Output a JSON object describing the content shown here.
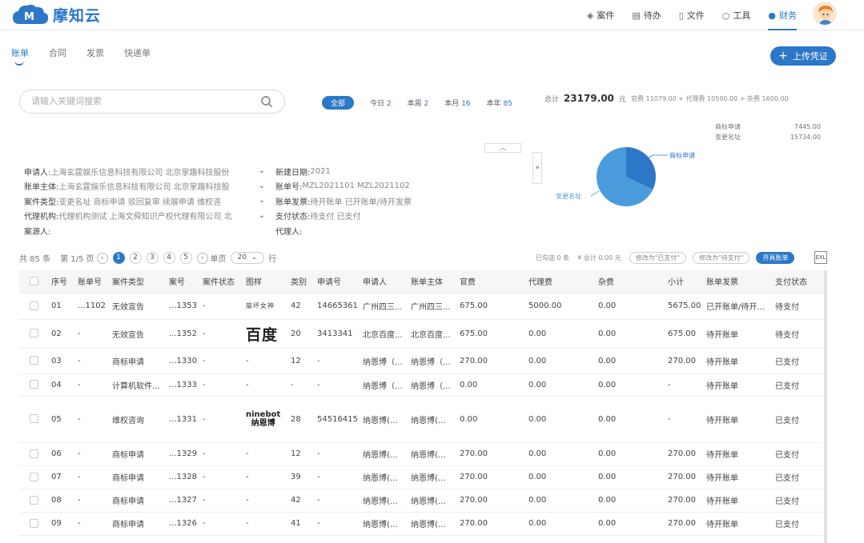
{
  "app": {
    "logo_text": "摩知云",
    "logo_mark": "M"
  },
  "topnav": [
    {
      "label": "案件",
      "icon": "layers-icon",
      "active": false
    },
    {
      "label": "待办",
      "icon": "calendar-icon",
      "active": false
    },
    {
      "label": "文件",
      "icon": "file-icon",
      "active": false
    },
    {
      "label": "工具",
      "icon": "search-tool-icon",
      "active": false
    },
    {
      "label": "财务",
      "icon": "money-bag-icon",
      "active": true
    }
  ],
  "subtabs": [
    {
      "label": "账单",
      "active": true
    },
    {
      "label": "合同",
      "active": false
    },
    {
      "label": "发票",
      "active": false
    },
    {
      "label": "快递单",
      "active": false
    }
  ],
  "upload_button": "上传凭证",
  "search": {
    "placeholder": "请输入关键词搜索"
  },
  "periods": [
    {
      "label": "全部",
      "count": "",
      "active": true
    },
    {
      "label": "今日",
      "count": "2",
      "active": false
    },
    {
      "label": "本周",
      "count": "2",
      "active": false
    },
    {
      "label": "本月",
      "count": "16",
      "active": false
    },
    {
      "label": "本年",
      "count": "85",
      "active": false
    }
  ],
  "summary": {
    "total_label": "总计",
    "total_amount": "23179.00",
    "total_unit": "元",
    "fee_detail": "官费 11079.00 + 代理费 10500.00 + 杂费 1600.00"
  },
  "legend": [
    {
      "name": "商标申请",
      "value": "7445.00"
    },
    {
      "name": "变更名址",
      "value": "15734.00"
    }
  ],
  "pie": {
    "colors": [
      "#2d77c8",
      "#4a9bdc"
    ],
    "labels": [
      "商标申请",
      "变更名址"
    ],
    "values": [
      7445.0,
      15734.0
    ]
  },
  "filters_left": [
    {
      "label": "申请人:",
      "value": "上海玄霆娱乐信息科技有限公司  北京掌趣科技股份"
    },
    {
      "label": "账单主体:",
      "value": "上海玄霆娱乐信息科技有限公司  北京掌趣科技股"
    },
    {
      "label": "案件类型:",
      "value": "变更名址  商标申请  驳回复审  续展申请  维权咨"
    },
    {
      "label": "代理机构:",
      "value": "代理机构测试  上海文舜知识产权代理有限公司  北"
    },
    {
      "label": "案源人:",
      "value": ""
    }
  ],
  "filters_right": [
    {
      "label": "新建日期:",
      "value": "2021"
    },
    {
      "label": "账单号:",
      "value": "MZL2021101  MZL2021102"
    },
    {
      "label": "账单发票:",
      "value": "待开账单  已开账单/待开发票"
    },
    {
      "label": "支付状态:",
      "value": "待支付  已支付"
    },
    {
      "label": "代理人:",
      "value": ""
    }
  ],
  "pager": {
    "total": "共 85 条",
    "page": "第 1/5 页",
    "pages": [
      "1",
      "2",
      "3",
      "4",
      "5"
    ],
    "per_page_label": "单页",
    "per_page": "20",
    "unit": "行"
  },
  "actions": {
    "selected": "已勾选 0 条",
    "sum": "¥  总计 0.00 元",
    "mark_paid": "修改为\"已支付\"",
    "mark_unpaid": "修改为\"待支付\"",
    "issue_bill": "开具账单",
    "excel": "EXL"
  },
  "table": {
    "columns": [
      "序号",
      "账单号",
      "案件类型",
      "案号",
      "案件状态",
      "图样",
      "类别",
      "申请号",
      "申请人",
      "账单主体",
      "官费",
      "代理费",
      "杂费",
      "小计",
      "账单发票",
      "支付状态"
    ],
    "rows": [
      {
        "no": "01",
        "bill": "...1102",
        "type": "无效宣告",
        "case": "...1353",
        "status": "-",
        "logo": "huanle",
        "logo_text": "崩坏女神",
        "cls": "42",
        "appno": "14665361",
        "applicant": "广州四三...",
        "subject": "广州四三...",
        "official": "675.00",
        "agent": "5000.00",
        "misc": "0.00",
        "subtotal": "5675.00",
        "invoice": "已开账单/待开...",
        "pay": "待支付",
        "h": 33
      },
      {
        "no": "02",
        "bill": "-",
        "type": "无效宣告",
        "case": "...1352",
        "status": "-",
        "logo": "baidu",
        "logo_text": "百度",
        "cls": "20",
        "appno": "3413341",
        "applicant": "北京百度...",
        "subject": "北京百度...",
        "official": "675.00",
        "agent": "0.00",
        "misc": "0.00",
        "subtotal": "675.00",
        "invoice": "待开账单",
        "pay": "待支付",
        "h": 36
      },
      {
        "no": "03",
        "bill": "-",
        "type": "商标申请",
        "case": "...1330",
        "status": "-",
        "logo": "",
        "logo_text": "-",
        "cls": "12",
        "appno": "-",
        "applicant": "纳恩博（...",
        "subject": "纳恩博（...",
        "official": "270.00",
        "agent": "0.00",
        "misc": "0.00",
        "subtotal": "270.00",
        "invoice": "待开账单",
        "pay": "已支付",
        "h": 32
      },
      {
        "no": "04",
        "bill": "-",
        "type": "计算机软件...",
        "case": "...1333",
        "status": "-",
        "logo": "",
        "logo_text": "-",
        "cls": "-",
        "appno": "-",
        "applicant": "纳恩博（...",
        "subject": "纳恩博（...",
        "official": "0.00",
        "agent": "0.00",
        "misc": "0.00",
        "subtotal": "-",
        "invoice": "待开账单",
        "pay": "已支付",
        "h": 28
      },
      {
        "no": "05",
        "bill": "-",
        "type": "维权咨询",
        "case": "...1331",
        "status": "-",
        "logo": "ninebot",
        "logo_text": "ninebot",
        "logo_text2": "纳恩博",
        "cls": "28",
        "appno": "54516415",
        "applicant": "纳恩博(...",
        "subject": "纳恩博(...",
        "official": "0.00",
        "agent": "0.00",
        "misc": "0.00",
        "subtotal": "-",
        "invoice": "待开账单",
        "pay": "已支付",
        "h": 58
      },
      {
        "no": "06",
        "bill": "-",
        "type": "商标申请",
        "case": "...1329",
        "status": "-",
        "logo": "",
        "logo_text": "-",
        "cls": "12",
        "appno": "-",
        "applicant": "纳恩博(...",
        "subject": "纳恩博(...",
        "official": "270.00",
        "agent": "0.00",
        "misc": "0.00",
        "subtotal": "270.00",
        "invoice": "待开账单",
        "pay": "已支付",
        "h": 29
      },
      {
        "no": "07",
        "bill": "-",
        "type": "商标申请",
        "case": "...1328",
        "status": "-",
        "logo": "",
        "logo_text": "-",
        "cls": "39",
        "appno": "-",
        "applicant": "纳恩博(...",
        "subject": "纳恩博(...",
        "official": "270.00",
        "agent": "0.00",
        "misc": "0.00",
        "subtotal": "270.00",
        "invoice": "待开账单",
        "pay": "已支付",
        "h": 29
      },
      {
        "no": "08",
        "bill": "-",
        "type": "商标申请",
        "case": "...1327",
        "status": "-",
        "logo": "",
        "logo_text": "-",
        "cls": "42",
        "appno": "-",
        "applicant": "纳恩博(...",
        "subject": "纳恩博(...",
        "official": "270.00",
        "agent": "0.00",
        "misc": "0.00",
        "subtotal": "270.00",
        "invoice": "待开账单",
        "pay": "已支付",
        "h": 29
      },
      {
        "no": "09",
        "bill": "-",
        "type": "商标申请",
        "case": "...1326",
        "status": "-",
        "logo": "",
        "logo_text": "-",
        "cls": "41",
        "appno": "-",
        "applicant": "纳恩博(...",
        "subject": "纳恩博(...",
        "official": "270.00",
        "agent": "0.00",
        "misc": "0.00",
        "subtotal": "270.00",
        "invoice": "待开账单",
        "pay": "已支付",
        "h": 29
      }
    ]
  }
}
